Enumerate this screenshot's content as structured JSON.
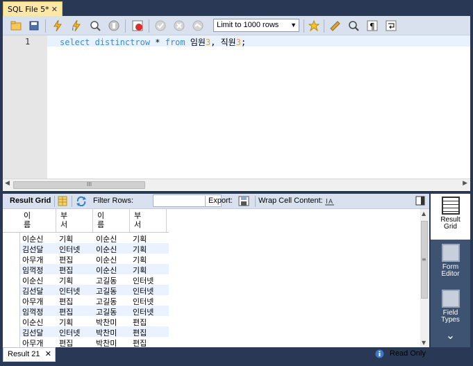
{
  "editor_tab": {
    "label": "SQL File 5*",
    "close": "✕"
  },
  "toolbar": {
    "limit_value": "Limit to 1000 rows",
    "icons": [
      "open-folder-icon",
      "save-icon",
      "execute-icon",
      "execute-current-icon",
      "explain-icon",
      "stop-icon",
      "toggle-error-icon",
      "commit-icon",
      "rollback-icon",
      "add-snippet-icon",
      "beautify-icon",
      "find-icon",
      "invisible-chars-icon",
      "wrap-icon"
    ]
  },
  "editor": {
    "line_number": "1",
    "code": {
      "kw1": "select distinctrow",
      "star": " * ",
      "kw2": "from",
      "t1": " 임원",
      "n1": "3",
      "comma": ", ",
      "t2": "직원",
      "n2": "3",
      "semi": ";"
    }
  },
  "result_toolbar": {
    "result_grid": "Result Grid",
    "filter_rows": "Filter Rows:",
    "filter_value": "",
    "export": "Export:",
    "wrap": "Wrap Cell Content:"
  },
  "grid": {
    "columns": [
      {
        "top": "이",
        "bottom": "름"
      },
      {
        "top": "부",
        "bottom": "서"
      },
      {
        "top": "이",
        "bottom": "름"
      },
      {
        "top": "부",
        "bottom": "서"
      }
    ],
    "rows": [
      [
        "이순신",
        "기획",
        "이순신",
        "기획"
      ],
      [
        "김선달",
        "인터넷",
        "이순신",
        "기획"
      ],
      [
        "아무개",
        "편집",
        "이순신",
        "기획"
      ],
      [
        "임꺽정",
        "편집",
        "이순신",
        "기획"
      ],
      [
        "이순신",
        "기획",
        "고길동",
        "인터넷"
      ],
      [
        "김선달",
        "인터넷",
        "고길동",
        "인터넷"
      ],
      [
        "아무개",
        "편집",
        "고길동",
        "인터넷"
      ],
      [
        "임꺽정",
        "편집",
        "고길동",
        "인터넷"
      ],
      [
        "이순신",
        "기획",
        "박찬미",
        "편집"
      ],
      [
        "김선달",
        "인터넷",
        "박찬미",
        "편집"
      ],
      [
        "아무개",
        "편집",
        "박찬미",
        "편집"
      ]
    ]
  },
  "side_panel": {
    "result_grid": [
      "Result",
      "Grid"
    ],
    "form_editor": [
      "Form",
      "Editor"
    ],
    "field_types": [
      "Field",
      "Types"
    ]
  },
  "bottom": {
    "result_tab": "Result 21",
    "close": "✕",
    "status": "Read Only"
  },
  "colors": {
    "keyword": "#3A8DCF",
    "number": "#E19C37",
    "tab_active": "#FFE8A6",
    "frame": "#293955"
  }
}
